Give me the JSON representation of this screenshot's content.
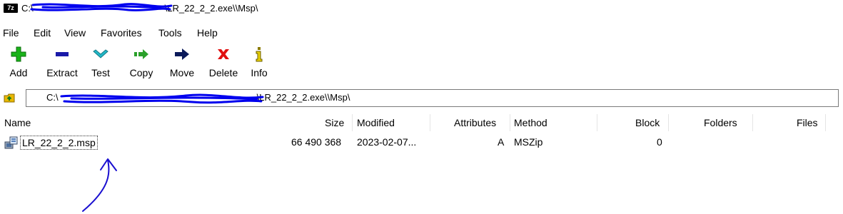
{
  "window": {
    "app_logo": "7z",
    "title_prefix": "C:\\",
    "title_suffix": "\\LR_22_2_2.exe\\\\Msp\\"
  },
  "menu": [
    "File",
    "Edit",
    "View",
    "Favorites",
    "Tools",
    "Help"
  ],
  "toolbar": {
    "add": "Add",
    "extract": "Extract",
    "test": "Test",
    "copy": "Copy",
    "move": "Move",
    "delete": "Delete",
    "info": "Info"
  },
  "address": {
    "prefix": "C:\\",
    "suffix": "\\LR_22_2_2.exe\\\\Msp\\"
  },
  "columns": [
    "Name",
    "Size",
    "Modified",
    "Attributes",
    "Method",
    "Block",
    "Folders",
    "Files"
  ],
  "rows": [
    {
      "name": "LR_22_2_2.msp",
      "size": "66 490 368",
      "modified": "2023-02-07...",
      "attributes": "A",
      "method": "MSZip",
      "block": "0",
      "folders": "",
      "files": ""
    }
  ],
  "colors": {
    "add_green": "#19b219",
    "extract_blue": "#1a1aa8",
    "test_cyan": "#22b8c8",
    "copy_green": "#2aa02a",
    "move_navy": "#0b1a5a",
    "delete_red": "#e01010",
    "info_olive": "#8a7a00",
    "annotation_ink": "#1a0fd0",
    "redaction_ink": "#0000ee"
  }
}
